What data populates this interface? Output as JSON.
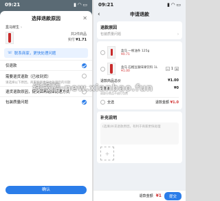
{
  "left": {
    "time": "09:21",
    "title": "选择退款原因",
    "store_name": "盒马鲜生",
    "product_count": "共2件商品",
    "paid_label": "实付",
    "paid_value": "¥1.71",
    "contact_text": "联系商家，更快处理问题",
    "reasons": [
      {
        "label": "仅退款",
        "sub": "",
        "selected": true
      },
      {
        "label": "需要退货退款（已收到货）",
        "sub": "请选择以下原因，商家能够更快地处理您的问题",
        "selected": false
      },
      {
        "label": "退货退款原因，提交后再选择处理方式",
        "sub": "",
        "selected": false
      },
      {
        "label": "包装质量问题",
        "sub": "",
        "selected": true
      }
    ],
    "confirm_label": "确认"
  },
  "right": {
    "time": "09:21",
    "title": "申请退款",
    "reason_section": {
      "title": "退款原因",
      "value": "包装质量问题"
    },
    "items": [
      {
        "name": "盒马 一根油条 125g",
        "price": "¥0.71",
        "qty": "1"
      },
      {
        "name": "盒马 石榴豆腐味果饮料 1L",
        "price": "¥1.00",
        "qty": "1"
      }
    ],
    "refund_goods_label": "退款商品总价",
    "refund_goods_value": "¥1.00",
    "pack_fee_label": "打包费",
    "pack_fee_sub": "退部分商品不退打包费",
    "pack_fee_value": "¥0",
    "select_all_label": "全选",
    "refund_amount_label": "退款金额",
    "refund_amount_value": "¥1.0",
    "desc_title": "补充说明",
    "desc_placeholder": "(选填)补充退款原因，有利于商家更快处理",
    "footer_label": "退款金额",
    "footer_value": "¥1",
    "submit_label": "提交"
  },
  "watermark": "线报酷-new.xianbao.fun"
}
